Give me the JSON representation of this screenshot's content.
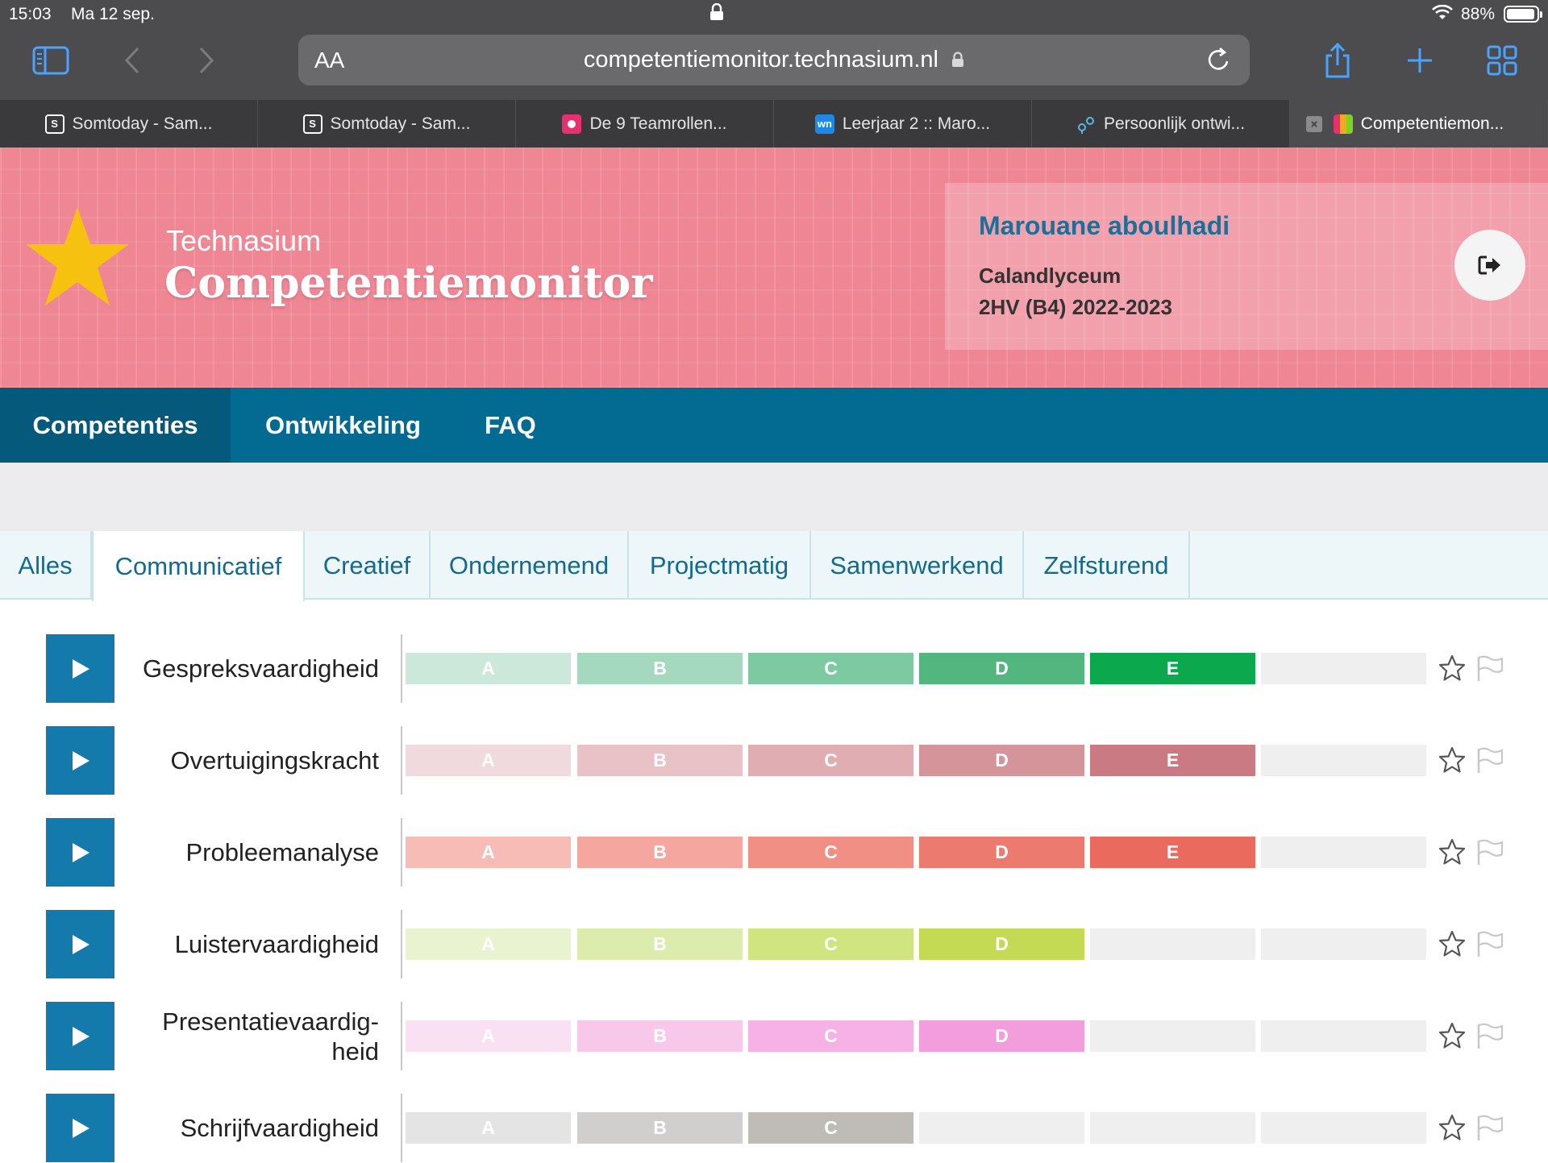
{
  "status_bar": {
    "time": "15:03",
    "date": "Ma 12 sep.",
    "battery": "88%"
  },
  "browser": {
    "url": "competentiemonitor.technasium.nl",
    "text_size_label": "AA",
    "tabs": [
      {
        "label": "Somtoday - Sam...",
        "icon": "somtoday-icon"
      },
      {
        "label": "Somtoday - Sam...",
        "icon": "somtoday-icon"
      },
      {
        "label": "De 9 Teamrollen...",
        "icon": "teamrollen-icon"
      },
      {
        "label": "Leerjaar 2 :: Maro...",
        "icon": "wn-icon",
        "icon_text": "wn"
      },
      {
        "label": "Persoonlijk ontwi...",
        "icon": "flow-icon"
      },
      {
        "label": "Competentiemon...",
        "icon": "competentiemonitor-icon",
        "active": true
      }
    ]
  },
  "header": {
    "subtitle": "Technasium",
    "title": "Competentiemonitor",
    "user": {
      "name": "Marouane aboulhadi",
      "school": "Calandlyceum",
      "class": "2HV (B4) 2022-2023"
    }
  },
  "nav": [
    {
      "label": "Competenties",
      "active": true
    },
    {
      "label": "Ontwikkeling"
    },
    {
      "label": "FAQ"
    }
  ],
  "categories": [
    {
      "label": "Alles"
    },
    {
      "label": "Communicatief",
      "active": true
    },
    {
      "label": "Creatief"
    },
    {
      "label": "Ondernemend"
    },
    {
      "label": "Projectmatig"
    },
    {
      "label": "Samenwerkend"
    },
    {
      "label": "Zelfsturend"
    }
  ],
  "levels": [
    "A",
    "B",
    "C",
    "D",
    "E"
  ],
  "competencies": [
    {
      "name": "Gespreksvaardigheid",
      "achieved": 5,
      "colors": [
        "#cbe8da",
        "#a5d9bf",
        "#7dc9a1",
        "#52b67f",
        "#0ba84e"
      ]
    },
    {
      "name": "Overtuigingskracht",
      "achieved": 5,
      "colors": [
        "#f1dadd",
        "#e8c2c6",
        "#e0adb2",
        "#d5949a",
        "#c97a82"
      ]
    },
    {
      "name": "Probleemanalyse",
      "achieved": 5,
      "colors": [
        "#f8bcb6",
        "#f5a69e",
        "#f18f85",
        "#ec7a6e",
        "#ea6b5e"
      ]
    },
    {
      "name": "Luistervaardigheid",
      "achieved": 4,
      "colors": [
        "#e9f3cf",
        "#dcecac",
        "#d0e47f",
        "#c3da52",
        "#efefef"
      ]
    },
    {
      "name": "Presentatievaardig-heid",
      "achieved": 4,
      "colors": [
        "#fae0f3",
        "#f8c8eb",
        "#f6b2e4",
        "#f39edc",
        "#efefef"
      ]
    },
    {
      "name": "Schrijfvaardigheid",
      "achieved": 3,
      "colors": [
        "#e4e4e4",
        "#d0cfcd",
        "#bfbcb8",
        "#efefef",
        "#efefef"
      ]
    }
  ],
  "ui_colors": {
    "header_pink": "#ef8694",
    "nav_blue": "#036b92",
    "play_blue": "#137aab",
    "user_name_blue": "#1c6f98",
    "empty_level": "#efefef"
  }
}
